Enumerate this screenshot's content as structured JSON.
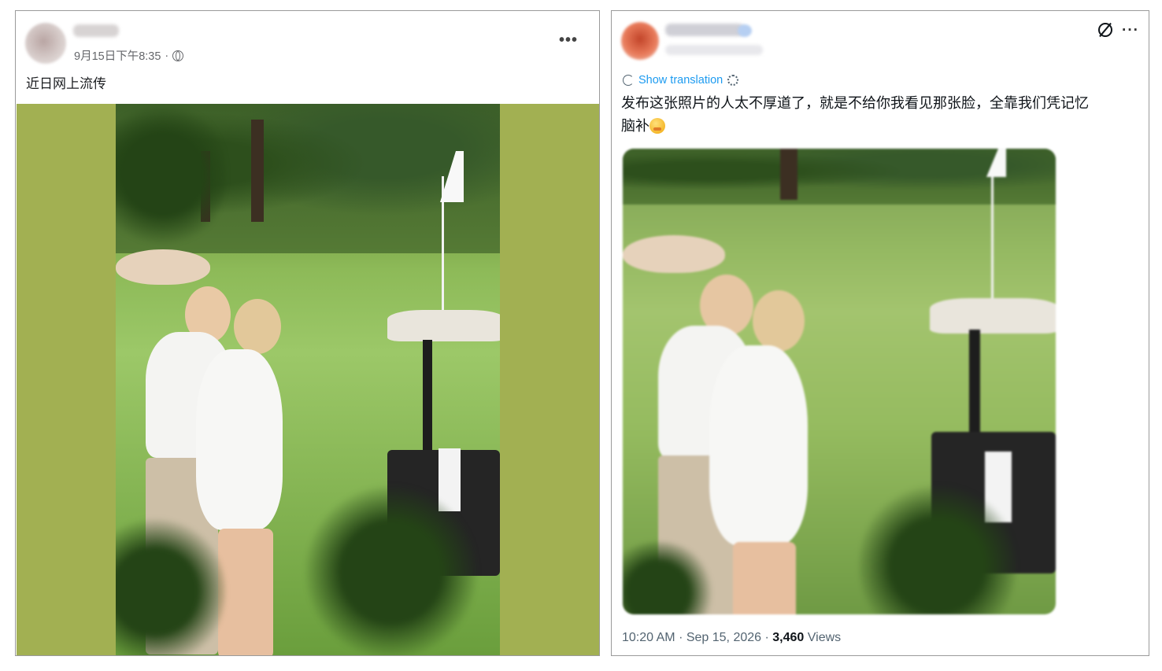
{
  "facebook_post": {
    "timestamp": "9月15日下午8:35",
    "separator": "·",
    "caption": "近日网上流传",
    "more_label": "•••"
  },
  "x_post": {
    "more_label": "···",
    "show_translation": "Show translation",
    "text_line1": "发布这张照片的人太不厚道了，就是不给你我看见那张脸，全靠我们凭记忆",
    "text_line2": "脑补",
    "time": "10:20 AM",
    "date": "Sep 15, 2026",
    "views_count": "3,460",
    "views_label": "Views",
    "dot": "·"
  },
  "colors": {
    "fb_photo_background": "#a2b052",
    "x_link_blue": "#1d9bf0",
    "secondary_text": "#65676b"
  },
  "icons": [
    "globe-icon",
    "more-icon",
    "grok-icon",
    "translate-icon",
    "settings-icon",
    "emoji-icon"
  ]
}
